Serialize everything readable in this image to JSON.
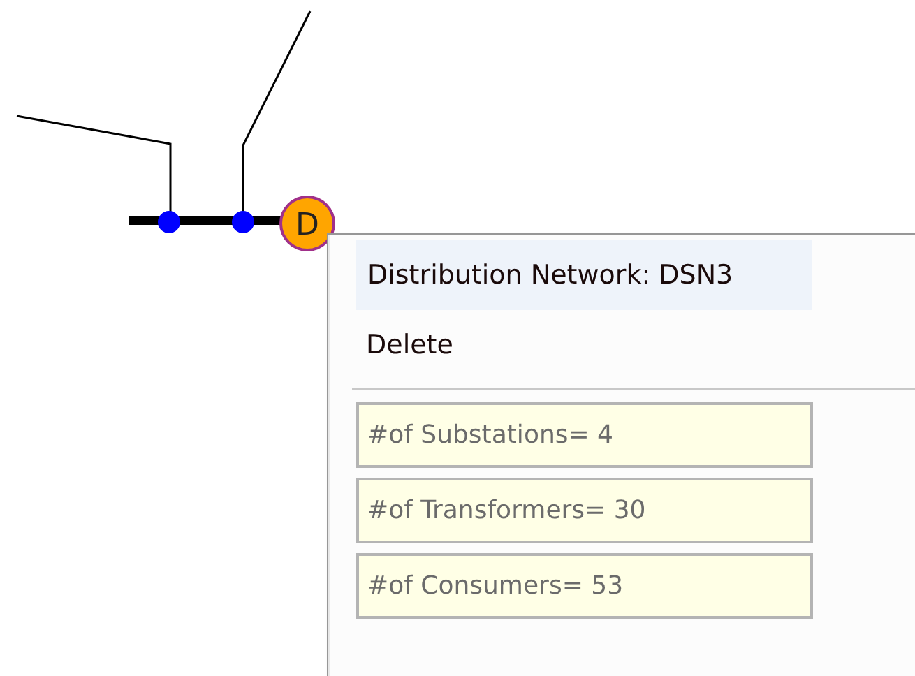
{
  "diagram": {
    "node": {
      "label": "D"
    }
  },
  "context_menu": {
    "header": "Distribution Network: DSN3",
    "items": [
      {
        "label": "Delete"
      }
    ],
    "stats": [
      {
        "value": "#of Substations= 4"
      },
      {
        "value": "#of Transformers= 30"
      },
      {
        "value": "#of Consumers= 53"
      }
    ]
  }
}
